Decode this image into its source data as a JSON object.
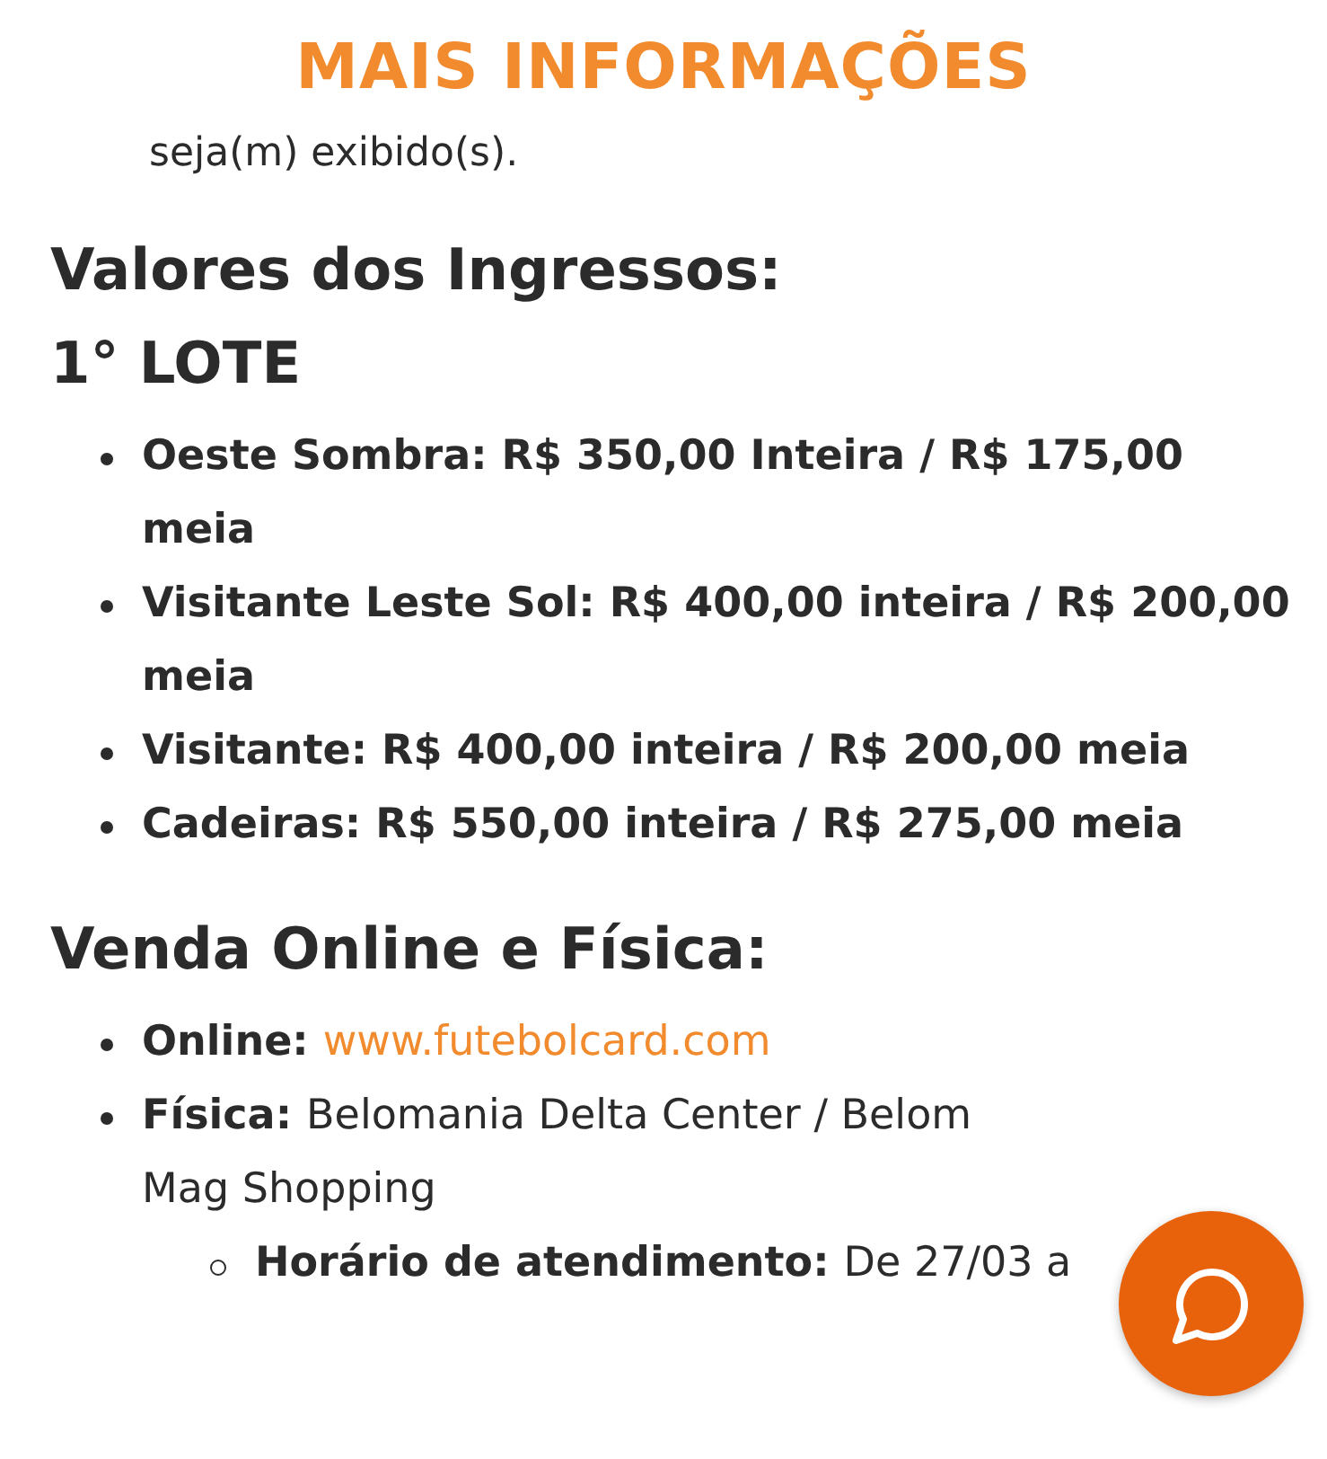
{
  "header": {
    "title": "MAIS INFORMAÇÕES"
  },
  "intro": "seja(m) exibido(s).",
  "sections": [
    {
      "heading": "Valores dos Ingressos:",
      "subheading": "1° LOTE",
      "items": [
        {
          "kind": "bold",
          "text": "Oeste Sombra: R$ 350,00 Inteira / R$ 175,00 meia"
        },
        {
          "kind": "bold",
          "text": "Visitante Leste Sol: R$ 400,00 inteira / R$ 200,00 meia"
        },
        {
          "kind": "bold",
          "text": "Visitante: R$ 400,00 inteira / R$ 200,00 meia"
        },
        {
          "kind": "bold",
          "text": "Cadeiras: R$ 550,00 inteira / R$ 275,00 meia"
        }
      ]
    },
    {
      "heading": "Venda Online e Física:",
      "items": [
        {
          "kind": "link",
          "label": "Online:",
          "text": "www.futebolcard.com"
        },
        {
          "kind": "plain",
          "label": "Física:",
          "lines": [
            "Belomania Delta Center / Belom",
            "Mag Shopping"
          ],
          "children": [
            {
              "kind": "plain",
              "label": "Horário de atendimento:",
              "lines": [
                "De 27/03 a"
              ]
            }
          ]
        }
      ]
    }
  ],
  "chat_button": {
    "kind": "chat"
  }
}
